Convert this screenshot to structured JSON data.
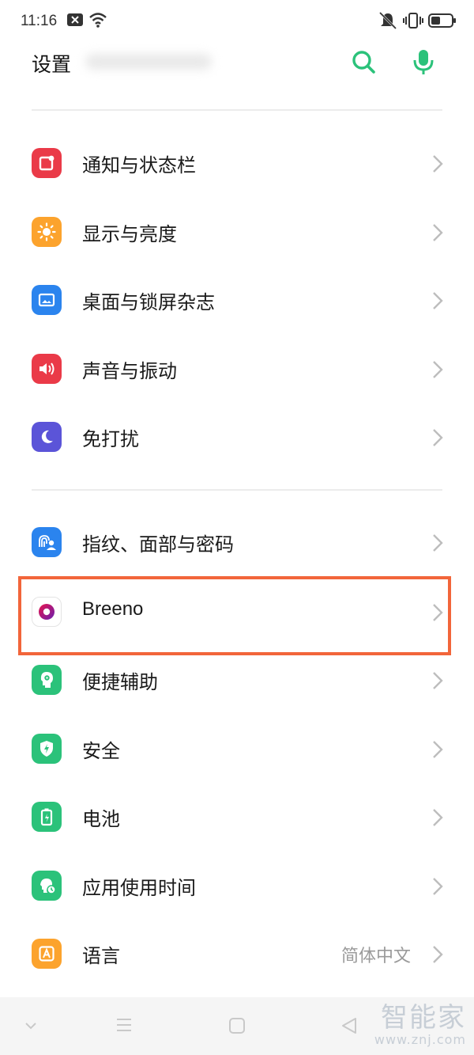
{
  "status_bar": {
    "time": "11:16"
  },
  "header": {
    "title": "设置",
    "search_icon": "search-icon",
    "mic_icon": "microphone-icon",
    "accent_color": "#2bc27a"
  },
  "settings": {
    "group1": [
      {
        "label": "通知与状态栏",
        "icon": "notification-icon",
        "color": "#ea3a48"
      },
      {
        "label": "显示与亮度",
        "icon": "brightness-icon",
        "color": "#fca32d"
      },
      {
        "label": "桌面与锁屏杂志",
        "icon": "wallpaper-icon",
        "color": "#2b84ee"
      },
      {
        "label": "声音与振动",
        "icon": "speaker-icon",
        "color": "#ea3a48"
      },
      {
        "label": "免打扰",
        "icon": "moon-icon",
        "color": "#5b54d8"
      }
    ],
    "group2": [
      {
        "label": "指纹、面部与密码",
        "icon": "fingerprint-face-icon",
        "color": "#2b84ee"
      },
      {
        "label": "Breeno",
        "icon": "breeno-icon",
        "color": "#a0169c"
      },
      {
        "label": "便捷辅助",
        "icon": "assist-icon",
        "color": "#2bc27a"
      },
      {
        "label": "安全",
        "icon": "shield-icon",
        "color": "#2bc27a"
      },
      {
        "label": "电池",
        "icon": "battery-icon",
        "color": "#2bc27a"
      },
      {
        "label": "应用使用时间",
        "icon": "app-usage-icon",
        "color": "#2bc27a"
      },
      {
        "label": "语言",
        "icon": "language-icon",
        "color": "#fca32d",
        "value": "简体中文"
      }
    ]
  },
  "highlight_color": "#f2653a",
  "watermark": {
    "text": "智能家",
    "url": "www.znj.com"
  }
}
